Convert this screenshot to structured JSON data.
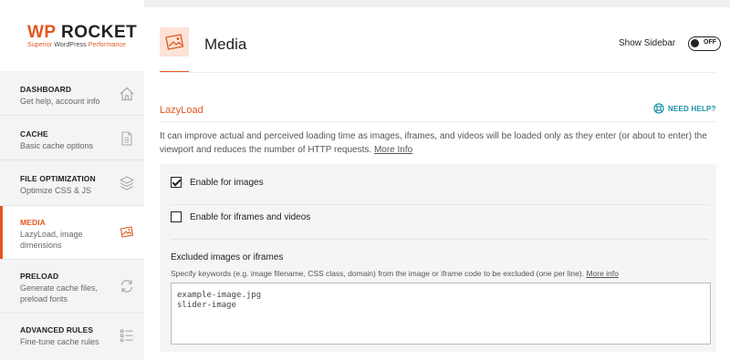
{
  "brand": {
    "name_wp": "WP",
    "name_rocket": "ROCKET",
    "tagline_a": "Superior ",
    "tagline_b": "WordPress",
    "tagline_c": " Performance"
  },
  "sidebar": {
    "items": [
      {
        "title": "DASHBOARD",
        "subtitle": "Get help, account info",
        "icon": "home-icon",
        "active": false
      },
      {
        "title": "CACHE",
        "subtitle": "Basic cache options",
        "icon": "document-icon",
        "active": false
      },
      {
        "title": "FILE OPTIMIZATION",
        "subtitle": "Optimize CSS & JS",
        "icon": "layers-icon",
        "active": false
      },
      {
        "title": "MEDIA",
        "subtitle": "LazyLoad, image dimensions",
        "icon": "media-icon",
        "active": true
      },
      {
        "title": "PRELOAD",
        "subtitle": "Generate cache files, preload fonts",
        "icon": "refresh-icon",
        "active": false
      },
      {
        "title": "ADVANCED RULES",
        "subtitle": "Fine-tune cache rules",
        "icon": "list-icon",
        "active": false
      }
    ]
  },
  "header": {
    "title": "Media",
    "show_sidebar_label": "Show Sidebar",
    "toggle_state": "OFF"
  },
  "section": {
    "title": "LazyLoad",
    "need_help": "NEED HELP?",
    "description": "It can improve actual and perceived loading time as images, iframes, and videos will be loaded only as they enter (or about to enter) the viewport and reduces the number of HTTP requests. ",
    "more_info": "More Info"
  },
  "options": {
    "enable_images": {
      "label": "Enable for images",
      "checked": true
    },
    "enable_iframes": {
      "label": "Enable for iframes and videos",
      "checked": false
    }
  },
  "excluded": {
    "title": "Excluded images or iframes",
    "description": "Specify keywords (e.g. image filename, CSS class, domain) from the image or iframe code to be excluded (one per line). ",
    "more_info": "More info",
    "value": "example-image.jpg\nslider-image"
  },
  "colors": {
    "accent": "#e2571e",
    "help": "#178fa3"
  }
}
